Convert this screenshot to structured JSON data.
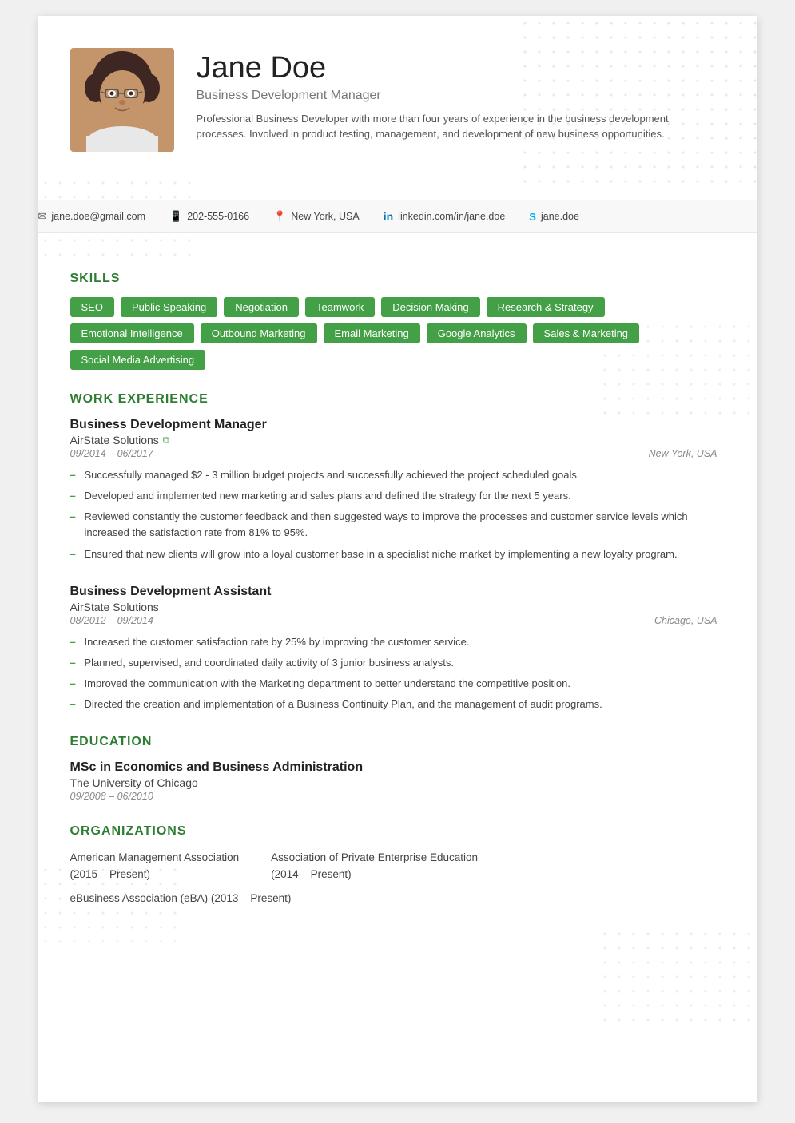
{
  "header": {
    "name": "Jane Doe",
    "title": "Business Development Manager",
    "bio": "Professional Business Developer with more than four years of experience in the business development processes. Involved in product testing, management, and development of new business opportunities."
  },
  "contact": {
    "email": "jane.doe@gmail.com",
    "phone": "202-555-0166",
    "location": "New York, USA",
    "linkedin": "linkedin.com/in/jane.doe",
    "skype": "jane.doe"
  },
  "skills": {
    "title": "SKILLS",
    "tags": [
      "SEO",
      "Public Speaking",
      "Negotiation",
      "Teamwork",
      "Decision Making",
      "Research & Strategy",
      "Emotional Intelligence",
      "Outbound Marketing",
      "Email Marketing",
      "Google Analytics",
      "Sales & Marketing",
      "Social Media Advertising"
    ]
  },
  "work_experience": {
    "title": "WORK EXPERIENCE",
    "jobs": [
      {
        "title": "Business Development Manager",
        "company": "AirState Solutions",
        "has_link": true,
        "dates": "09/2014 – 06/2017",
        "location": "New York, USA",
        "bullets": [
          "Successfully managed $2 - 3 million budget projects and successfully achieved the project scheduled goals.",
          "Developed and implemented new marketing and sales plans and defined the strategy for the next 5 years.",
          "Reviewed constantly the customer feedback and then suggested ways to improve the processes and customer service levels which increased the satisfaction rate from 81% to 95%.",
          "Ensured that new clients will grow into a loyal customer base in a specialist niche market by implementing a new loyalty program."
        ]
      },
      {
        "title": "Business Development Assistant",
        "company": "AirState Solutions",
        "has_link": false,
        "dates": "08/2012 – 09/2014",
        "location": "Chicago, USA",
        "bullets": [
          "Increased the customer satisfaction rate by 25% by improving the customer service.",
          "Planned, supervised, and coordinated daily activity of 3 junior business analysts.",
          "Improved the communication with the Marketing department to better understand the competitive position.",
          "Directed the creation and implementation of a Business Continuity Plan, and the management of audit programs."
        ]
      }
    ]
  },
  "education": {
    "title": "EDUCATION",
    "degree": "MSc in Economics and Business Administration",
    "school": "The University of Chicago",
    "dates": "09/2008 – 06/2010"
  },
  "organizations": {
    "title": "ORGANIZATIONS",
    "items": [
      {
        "name": "American Management Association",
        "years": "(2015 – Present)"
      },
      {
        "name": "Association of Private Enterprise Education",
        "years": "(2014 – Present)"
      }
    ],
    "single_item": "eBusiness Association (eBA) (2013 – Present)"
  }
}
